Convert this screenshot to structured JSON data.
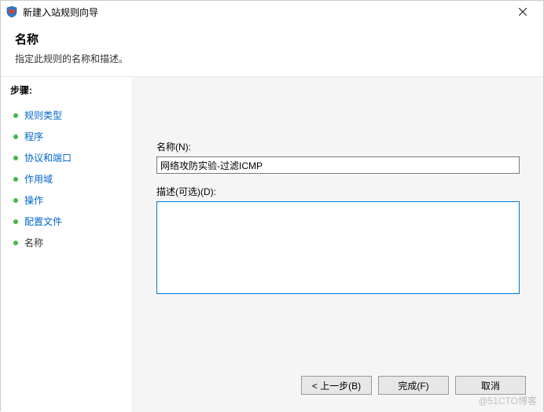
{
  "window": {
    "title": "新建入站规则向导"
  },
  "header": {
    "title": "名称",
    "subtitle": "指定此规则的名称和描述。"
  },
  "sidebar": {
    "steps_label": "步骤:",
    "items": [
      {
        "label": "规则类型",
        "current": false
      },
      {
        "label": "程序",
        "current": false
      },
      {
        "label": "协议和端口",
        "current": false
      },
      {
        "label": "作用域",
        "current": false
      },
      {
        "label": "操作",
        "current": false
      },
      {
        "label": "配置文件",
        "current": false
      },
      {
        "label": "名称",
        "current": true
      }
    ]
  },
  "form": {
    "name_label": "名称(N):",
    "name_value": "网络攻防实验-过滤ICMP",
    "desc_label": "描述(可选)(D):",
    "desc_value": ""
  },
  "buttons": {
    "back": "< 上一步(B)",
    "finish": "完成(F)",
    "cancel": "取消"
  },
  "watermark": "@51CTO博客"
}
